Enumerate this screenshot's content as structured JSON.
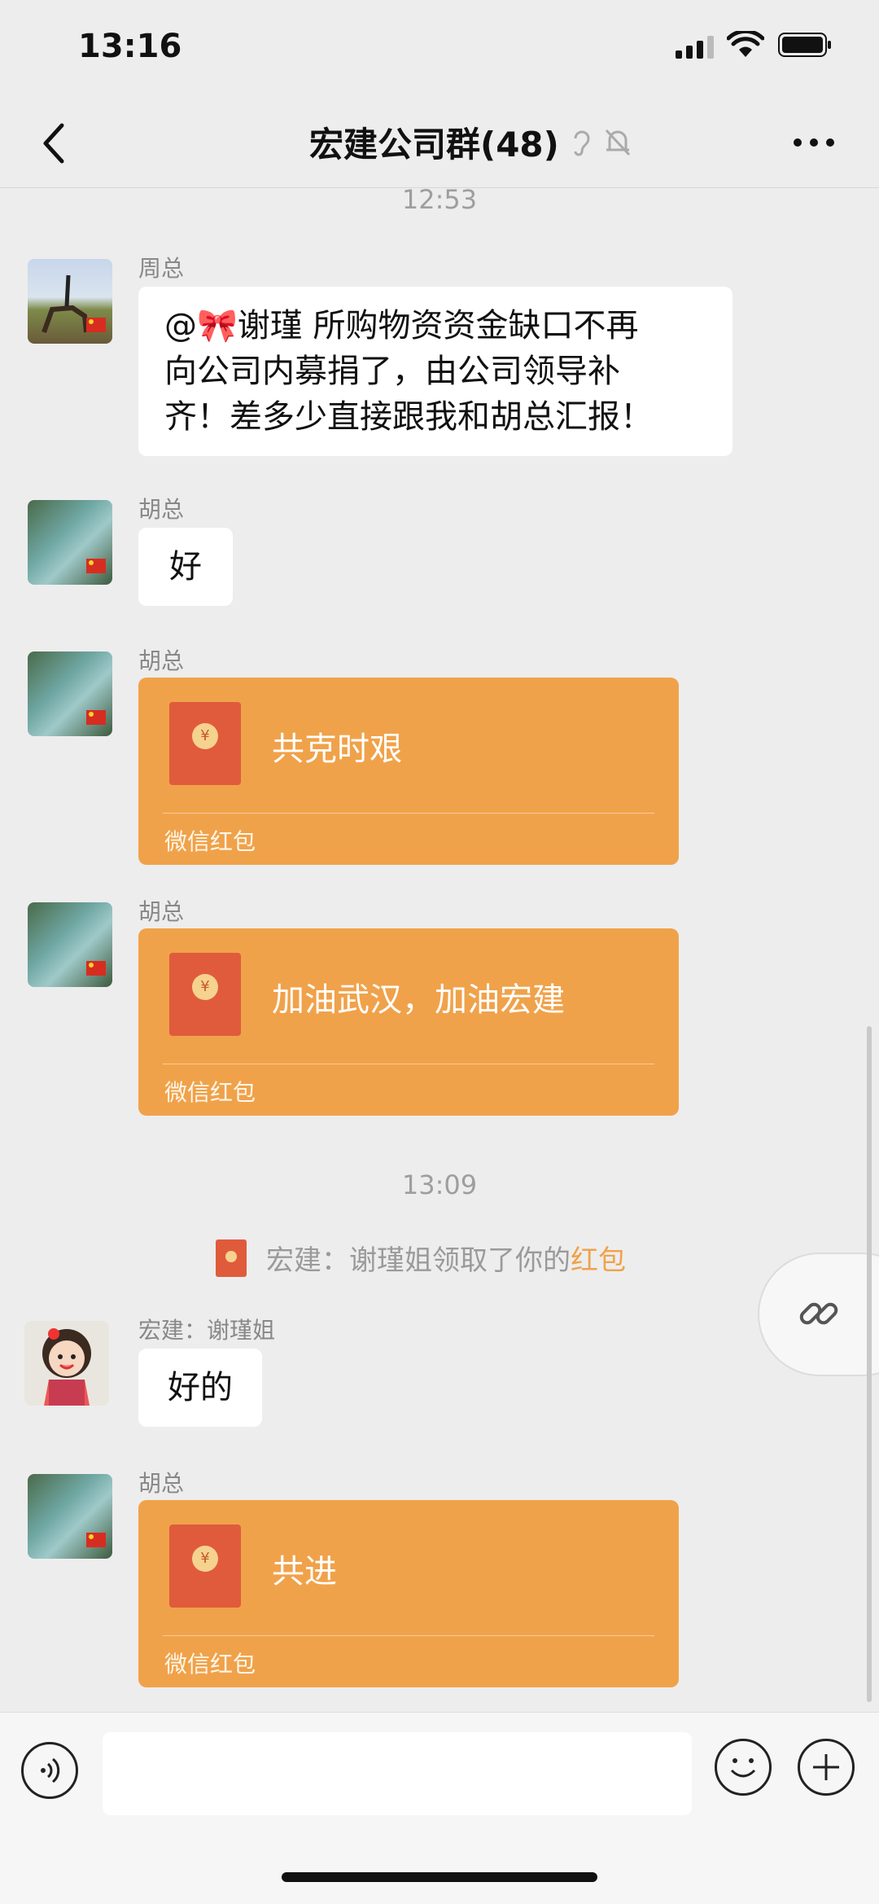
{
  "status_bar": {
    "time": "13:16"
  },
  "header": {
    "title": "宏建公司群(48)"
  },
  "messages": {
    "ts1": "12:53",
    "m1": {
      "sender": "周总",
      "text_line1": "@🎀谢瑾 所购物资资金缺口不再",
      "text_line2": "向公司内募捐了，由公司领导补",
      "text_line3": "齐！差多少直接跟我和胡总汇报！"
    },
    "m2": {
      "sender": "胡总",
      "text": "好"
    },
    "m3": {
      "sender": "胡总",
      "title": "共克时艰",
      "label": "微信红包"
    },
    "m4": {
      "sender": "胡总",
      "title": "加油武汉，加油宏建",
      "label": "微信红包"
    },
    "ts2": "13:09",
    "notice": {
      "prefix": "宏建：谢瑾姐领取了你的",
      "highlight": "红包"
    },
    "m5": {
      "sender": "宏建：谢瑾姐",
      "text": "好的"
    },
    "m6": {
      "sender": "胡总",
      "title": "共进",
      "label": "微信红包"
    }
  },
  "colors": {
    "red_packet": "#f0a24a",
    "envelope": "#e05b3c",
    "background": "#ededed"
  }
}
